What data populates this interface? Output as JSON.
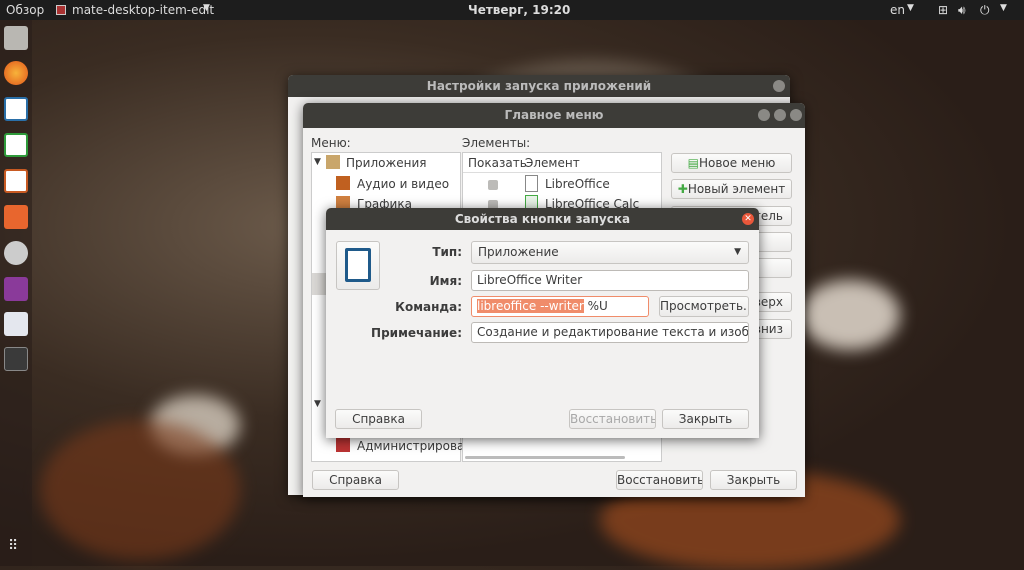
{
  "topbar": {
    "overview": "Обзор",
    "app_name": "mate-desktop-item-edit",
    "clock": "Четверг, 19:20",
    "lang": "en"
  },
  "dock": {
    "items": [
      "file-cabinet-icon",
      "firefox-icon",
      "libreoffice-writer-icon",
      "libreoffice-calc-icon",
      "libreoffice-impress-icon",
      "software-center-icon",
      "system-settings-icon",
      "remote-desktop-icon",
      "text-editor-icon",
      "screenshot-app-icon"
    ],
    "apps_grid": "apps-grid-icon"
  },
  "back_window": {
    "title": "Настройки запуска приложений"
  },
  "main_window": {
    "title": "Главное меню",
    "menu_label": "Меню:",
    "elements_label": "Элементы:",
    "tree": [
      {
        "label": "Приложения",
        "icon": "applications-icon"
      },
      {
        "label": "Аудио и видео",
        "icon": "multimedia-icon"
      },
      {
        "label": "Графика",
        "icon": "graphics-icon"
      },
      {
        "label": "Администрировани",
        "icon": "admin-icon"
      }
    ],
    "columns": [
      "Показать",
      "Элемент"
    ],
    "rows": [
      {
        "show": true,
        "name": "LibreOffice"
      },
      {
        "show": true,
        "name": "LibreOffice Calc"
      }
    ],
    "side_buttons": [
      "Новое меню",
      "Новый элемент",
      "тель",
      "",
      "",
      "вверх",
      "вниз"
    ],
    "help": "Справка",
    "revert": "Восстановить",
    "close": "Закрыть"
  },
  "dialog": {
    "title": "Свойства кнопки запуска",
    "type_label": "Тип:",
    "type_value": "Приложение",
    "name_label": "Имя:",
    "name_value": "LibreOffice Writer",
    "command_label": "Команда:",
    "command_selected": "libreoffice --writer",
    "command_rest": " %U",
    "browse": "Просмотреть...",
    "comment_label": "Примечание:",
    "comment_value": "Создание и редактирование текста и изображений",
    "help": "Справка",
    "revert": "Восстановить",
    "close": "Закрыть",
    "accent": "#f08c6a"
  }
}
